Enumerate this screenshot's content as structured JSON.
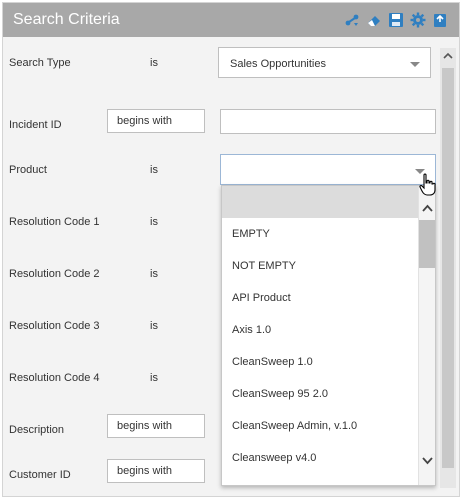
{
  "header": {
    "title": "Search Criteria"
  },
  "header_icons": [
    "share-icon",
    "eraser-icon",
    "save-icon",
    "gear-icon",
    "export-icon"
  ],
  "fields": {
    "search_type": {
      "label": "Search Type",
      "operator": "is",
      "value": "Sales Opportunities"
    },
    "incident_id": {
      "label": "Incident ID",
      "operator": "begins with",
      "value": ""
    },
    "product": {
      "label": "Product",
      "operator": "is",
      "value": ""
    },
    "resolution_code_1": {
      "label": "Resolution Code 1",
      "operator": "is"
    },
    "resolution_code_2": {
      "label": "Resolution Code 2",
      "operator": "is"
    },
    "resolution_code_3": {
      "label": "Resolution Code 3",
      "operator": "is"
    },
    "resolution_code_4": {
      "label": "Resolution Code 4",
      "operator": "is"
    },
    "description": {
      "label": "Description",
      "operator": "begins with"
    },
    "customer_id": {
      "label": "Customer ID",
      "operator": "begins with"
    }
  },
  "product_dropdown": {
    "options": [
      "",
      "EMPTY",
      "NOT EMPTY",
      "API Product",
      "Axis 1.0",
      "CleanSweep 1.0",
      "CleanSweep 95 2.0",
      "CleanSweep Admin, v.1.0",
      "Cleansweep v4.0"
    ],
    "highlighted_index": 0
  },
  "colors": {
    "header_bg": "#a8a8a8",
    "icon_blue": "#2f7fc1",
    "panel_bg": "#f3f3f3",
    "highlight": "#dcdcdc"
  }
}
